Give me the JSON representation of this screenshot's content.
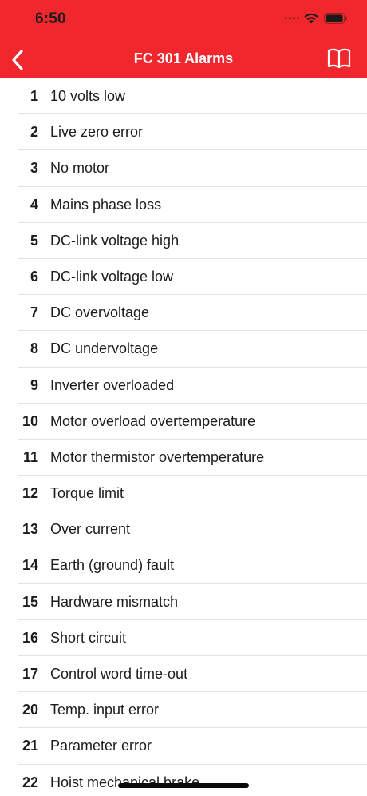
{
  "status_bar": {
    "time": "6:50",
    "signal": "••••"
  },
  "nav": {
    "title": "FC 301 Alarms",
    "back_icon": "chevron-left-icon",
    "book_icon": "book-icon"
  },
  "colors": {
    "header": "#f0282d",
    "text": "#1c1c1e",
    "separator": "#e3e3e6"
  },
  "alarms": [
    {
      "num": "1",
      "label": "10 volts low"
    },
    {
      "num": "2",
      "label": "Live zero error"
    },
    {
      "num": "3",
      "label": "No motor"
    },
    {
      "num": "4",
      "label": "Mains phase loss"
    },
    {
      "num": "5",
      "label": "DC-link voltage high"
    },
    {
      "num": "6",
      "label": "DC-link voltage low"
    },
    {
      "num": "7",
      "label": "DC overvoltage"
    },
    {
      "num": "8",
      "label": "DC undervoltage"
    },
    {
      "num": "9",
      "label": "Inverter overloaded"
    },
    {
      "num": "10",
      "label": "Motor overload overtemperature"
    },
    {
      "num": "11",
      "label": "Motor thermistor overtemperature"
    },
    {
      "num": "12",
      "label": "Torque limit"
    },
    {
      "num": "13",
      "label": "Over current"
    },
    {
      "num": "14",
      "label": "Earth (ground) fault"
    },
    {
      "num": "15",
      "label": "Hardware mismatch"
    },
    {
      "num": "16",
      "label": "Short circuit"
    },
    {
      "num": "17",
      "label": "Control word time-out"
    },
    {
      "num": "20",
      "label": "Temp. input error"
    },
    {
      "num": "21",
      "label": "Parameter error"
    },
    {
      "num": "22",
      "label": "Hoist mechanical brake"
    }
  ]
}
